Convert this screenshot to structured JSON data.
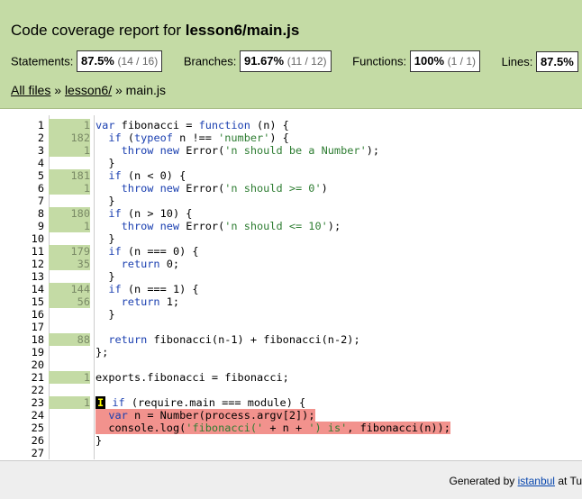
{
  "header": {
    "title_prefix": "Code coverage report for",
    "title_file": "lesson6/main.js",
    "metrics": [
      {
        "label": "Statements:",
        "pct": "87.5%",
        "frac": "(14 / 16)"
      },
      {
        "label": "Branches:",
        "pct": "91.67%",
        "frac": "(11 / 12)"
      },
      {
        "label": "Functions:",
        "pct": "100%",
        "frac": "(1 / 1)"
      },
      {
        "label": "Lines:",
        "pct": "87.5%",
        "frac": ""
      }
    ],
    "breadcrumb": {
      "all_files": "All files",
      "sep1": "»",
      "folder": "lesson6/",
      "sep2": "»",
      "file": "main.js"
    }
  },
  "code_lines": [
    {
      "n": "1",
      "hits": "1",
      "code": "var fibonacci = function (n) {"
    },
    {
      "n": "2",
      "hits": "182",
      "code": "  if (typeof n !== 'number') {"
    },
    {
      "n": "3",
      "hits": "1",
      "code": "    throw new Error('n should be a Number');"
    },
    {
      "n": "4",
      "hits": "",
      "code": "  }"
    },
    {
      "n": "5",
      "hits": "181",
      "code": "  if (n < 0) {"
    },
    {
      "n": "6",
      "hits": "1",
      "code": "    throw new Error('n should >= 0')"
    },
    {
      "n": "7",
      "hits": "",
      "code": "  }"
    },
    {
      "n": "8",
      "hits": "180",
      "code": "  if (n > 10) {"
    },
    {
      "n": "9",
      "hits": "1",
      "code": "    throw new Error('n should <= 10');"
    },
    {
      "n": "10",
      "hits": "",
      "code": "  }"
    },
    {
      "n": "11",
      "hits": "179",
      "code": "  if (n === 0) {"
    },
    {
      "n": "12",
      "hits": "35",
      "code": "    return 0;"
    },
    {
      "n": "13",
      "hits": "",
      "code": "  }"
    },
    {
      "n": "14",
      "hits": "144",
      "code": "  if (n === 1) {"
    },
    {
      "n": "15",
      "hits": "56",
      "code": "    return 1;"
    },
    {
      "n": "16",
      "hits": "",
      "code": "  }"
    },
    {
      "n": "17",
      "hits": "",
      "code": ""
    },
    {
      "n": "18",
      "hits": "88",
      "code": "  return fibonacci(n-1) + fibonacci(n-2);"
    },
    {
      "n": "19",
      "hits": "",
      "code": "};"
    },
    {
      "n": "20",
      "hits": "",
      "code": ""
    },
    {
      "n": "21",
      "hits": "1",
      "code": "exports.fibonacci = fibonacci;"
    },
    {
      "n": "22",
      "hits": "",
      "code": ""
    },
    {
      "n": "23",
      "hits": "1",
      "code": " if (require.main === module) {",
      "branch_mark": "I"
    },
    {
      "n": "24",
      "hits": "",
      "code": "  var n = Number(process.argv[2]);",
      "uncovered": true
    },
    {
      "n": "25",
      "hits": "",
      "code": "  console.log('fibonacci(' + n + ') is', fibonacci(n));",
      "uncovered": true
    },
    {
      "n": "26",
      "hits": "",
      "code": "}"
    },
    {
      "n": "27",
      "hits": "",
      "code": ""
    }
  ],
  "footer": {
    "generated_by": "Generated by",
    "tool": "istanbul",
    "at": "at Tu"
  },
  "colors": {
    "header_bg": "#c4dba5",
    "covered_bg": "#c4dba5",
    "uncovered_bg": "#f2928d",
    "keyword": "#1a3fb0",
    "string": "#2e7d32"
  }
}
